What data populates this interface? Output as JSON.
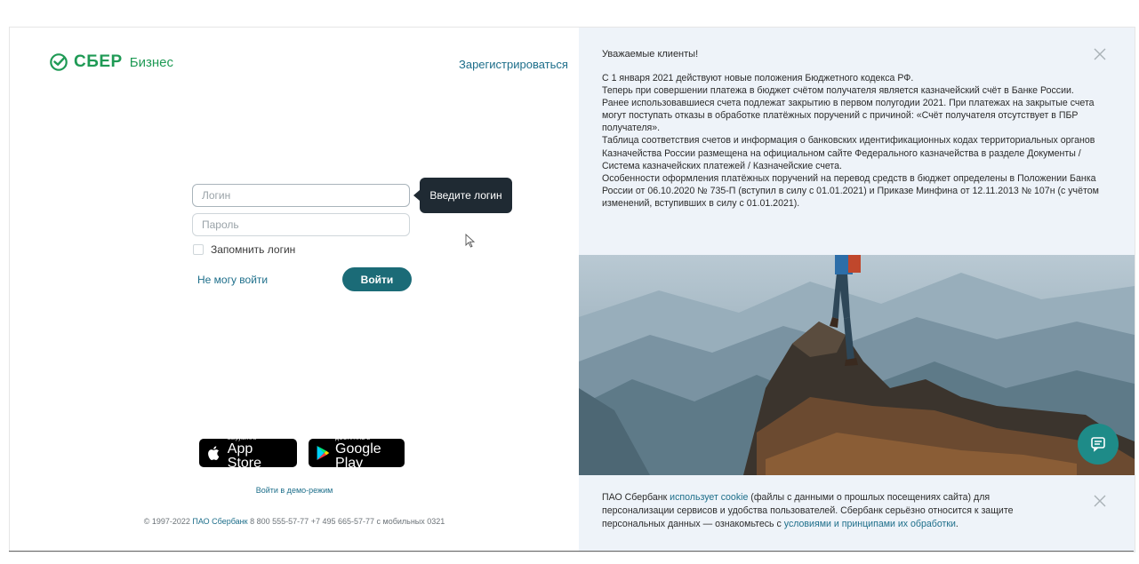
{
  "brand": {
    "name": "СБЕР",
    "suffix": "Бизнес",
    "color": "#1f9a55"
  },
  "header": {
    "register_label": "Зарегистрироваться"
  },
  "login_form": {
    "login_placeholder": "Логин",
    "password_placeholder": "Пароль",
    "tooltip": "Введите логин",
    "remember_label": "Запомнить логин",
    "cant_login_label": "Не могу войти",
    "submit_label": "Войти"
  },
  "stores": {
    "apple": {
      "small": "Загрузите в",
      "big": "App Store",
      "icon": "apple-icon"
    },
    "google": {
      "small": "ДОСТУПНО В",
      "big": "Google Play",
      "icon": "google-play-icon"
    }
  },
  "demo_label": "Войти в демо-режим",
  "footer": {
    "years": "© 1997-2022",
    "company": "ПАО Сбербанк",
    "phone1": "8 800 555-57-77",
    "phone2": "+7 495 665-57-77",
    "mobile": "с мобильных 0321"
  },
  "notice": {
    "title": "Уважаемые клиенты!",
    "paragraphs": [
      "С 1 января 2021 действуют новые положения Бюджетного кодекса РФ.",
      "Теперь при совершении платежа в бюджет счётом получателя является казначейский счёт в Банке России.",
      "Ранее использовавшиеся счета подлежат закрытию в первом полугодии 2021. При платежах на закрытые счета могут поступать отказы в обработке платёжных поручений с причиной: «Счёт получателя отсутствует в ПБР получателя».",
      "Таблица соответствия счетов и информация о банковских идентификационных кодах территориальных органов Казначейства России размещена на официальном сайте Федерального казначейства в разделе Документы / Система казначейских платежей / Казначейские счета.",
      "Особенности оформления платёжных поручений на перевод средств в бюджет определены в Положении Банка России от 06.10.2020 № 735-П (вступил в силу с 01.01.2021) и Приказе Минфина от 12.11.2013 № 107н (с учётом изменений, вступивших в силу с 01.01.2021)."
    ]
  },
  "cookie": {
    "part1": "ПАО Сбербанк ",
    "link1": "использует cookie",
    "part2": " (файлы с данными о прошлых посещениях сайта) для персонализации сервисов и удобства пользователей. Сбербанк серьёзно относится к защите персональных данных — ознакомьтесь с ",
    "link2": "условиями и принципами их обработки",
    "part3": "."
  },
  "colors": {
    "accent": "#1b6b77",
    "link": "#1d6e8a",
    "panel": "#eef3f9"
  }
}
